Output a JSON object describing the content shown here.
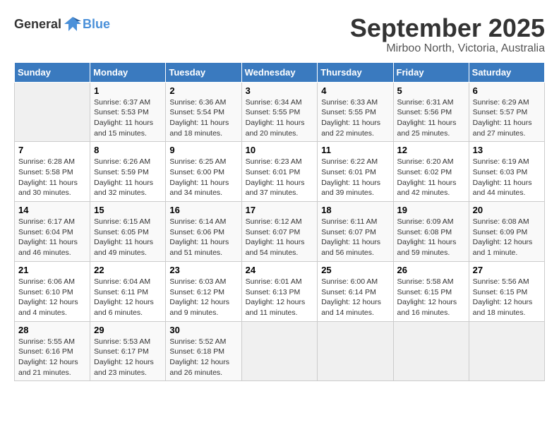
{
  "header": {
    "logo_general": "General",
    "logo_blue": "Blue",
    "month": "September 2025",
    "location": "Mirboo North, Victoria, Australia"
  },
  "days_of_week": [
    "Sunday",
    "Monday",
    "Tuesday",
    "Wednesday",
    "Thursday",
    "Friday",
    "Saturday"
  ],
  "weeks": [
    [
      {
        "day": "",
        "info": ""
      },
      {
        "day": "1",
        "info": "Sunrise: 6:37 AM\nSunset: 5:53 PM\nDaylight: 11 hours\nand 15 minutes."
      },
      {
        "day": "2",
        "info": "Sunrise: 6:36 AM\nSunset: 5:54 PM\nDaylight: 11 hours\nand 18 minutes."
      },
      {
        "day": "3",
        "info": "Sunrise: 6:34 AM\nSunset: 5:55 PM\nDaylight: 11 hours\nand 20 minutes."
      },
      {
        "day": "4",
        "info": "Sunrise: 6:33 AM\nSunset: 5:55 PM\nDaylight: 11 hours\nand 22 minutes."
      },
      {
        "day": "5",
        "info": "Sunrise: 6:31 AM\nSunset: 5:56 PM\nDaylight: 11 hours\nand 25 minutes."
      },
      {
        "day": "6",
        "info": "Sunrise: 6:29 AM\nSunset: 5:57 PM\nDaylight: 11 hours\nand 27 minutes."
      }
    ],
    [
      {
        "day": "7",
        "info": "Sunrise: 6:28 AM\nSunset: 5:58 PM\nDaylight: 11 hours\nand 30 minutes."
      },
      {
        "day": "8",
        "info": "Sunrise: 6:26 AM\nSunset: 5:59 PM\nDaylight: 11 hours\nand 32 minutes."
      },
      {
        "day": "9",
        "info": "Sunrise: 6:25 AM\nSunset: 6:00 PM\nDaylight: 11 hours\nand 34 minutes."
      },
      {
        "day": "10",
        "info": "Sunrise: 6:23 AM\nSunset: 6:01 PM\nDaylight: 11 hours\nand 37 minutes."
      },
      {
        "day": "11",
        "info": "Sunrise: 6:22 AM\nSunset: 6:01 PM\nDaylight: 11 hours\nand 39 minutes."
      },
      {
        "day": "12",
        "info": "Sunrise: 6:20 AM\nSunset: 6:02 PM\nDaylight: 11 hours\nand 42 minutes."
      },
      {
        "day": "13",
        "info": "Sunrise: 6:19 AM\nSunset: 6:03 PM\nDaylight: 11 hours\nand 44 minutes."
      }
    ],
    [
      {
        "day": "14",
        "info": "Sunrise: 6:17 AM\nSunset: 6:04 PM\nDaylight: 11 hours\nand 46 minutes."
      },
      {
        "day": "15",
        "info": "Sunrise: 6:15 AM\nSunset: 6:05 PM\nDaylight: 11 hours\nand 49 minutes."
      },
      {
        "day": "16",
        "info": "Sunrise: 6:14 AM\nSunset: 6:06 PM\nDaylight: 11 hours\nand 51 minutes."
      },
      {
        "day": "17",
        "info": "Sunrise: 6:12 AM\nSunset: 6:07 PM\nDaylight: 11 hours\nand 54 minutes."
      },
      {
        "day": "18",
        "info": "Sunrise: 6:11 AM\nSunset: 6:07 PM\nDaylight: 11 hours\nand 56 minutes."
      },
      {
        "day": "19",
        "info": "Sunrise: 6:09 AM\nSunset: 6:08 PM\nDaylight: 11 hours\nand 59 minutes."
      },
      {
        "day": "20",
        "info": "Sunrise: 6:08 AM\nSunset: 6:09 PM\nDaylight: 12 hours\nand 1 minute."
      }
    ],
    [
      {
        "day": "21",
        "info": "Sunrise: 6:06 AM\nSunset: 6:10 PM\nDaylight: 12 hours\nand 4 minutes."
      },
      {
        "day": "22",
        "info": "Sunrise: 6:04 AM\nSunset: 6:11 PM\nDaylight: 12 hours\nand 6 minutes."
      },
      {
        "day": "23",
        "info": "Sunrise: 6:03 AM\nSunset: 6:12 PM\nDaylight: 12 hours\nand 9 minutes."
      },
      {
        "day": "24",
        "info": "Sunrise: 6:01 AM\nSunset: 6:13 PM\nDaylight: 12 hours\nand 11 minutes."
      },
      {
        "day": "25",
        "info": "Sunrise: 6:00 AM\nSunset: 6:14 PM\nDaylight: 12 hours\nand 14 minutes."
      },
      {
        "day": "26",
        "info": "Sunrise: 5:58 AM\nSunset: 6:15 PM\nDaylight: 12 hours\nand 16 minutes."
      },
      {
        "day": "27",
        "info": "Sunrise: 5:56 AM\nSunset: 6:15 PM\nDaylight: 12 hours\nand 18 minutes."
      }
    ],
    [
      {
        "day": "28",
        "info": "Sunrise: 5:55 AM\nSunset: 6:16 PM\nDaylight: 12 hours\nand 21 minutes."
      },
      {
        "day": "29",
        "info": "Sunrise: 5:53 AM\nSunset: 6:17 PM\nDaylight: 12 hours\nand 23 minutes."
      },
      {
        "day": "30",
        "info": "Sunrise: 5:52 AM\nSunset: 6:18 PM\nDaylight: 12 hours\nand 26 minutes."
      },
      {
        "day": "",
        "info": ""
      },
      {
        "day": "",
        "info": ""
      },
      {
        "day": "",
        "info": ""
      },
      {
        "day": "",
        "info": ""
      }
    ]
  ]
}
